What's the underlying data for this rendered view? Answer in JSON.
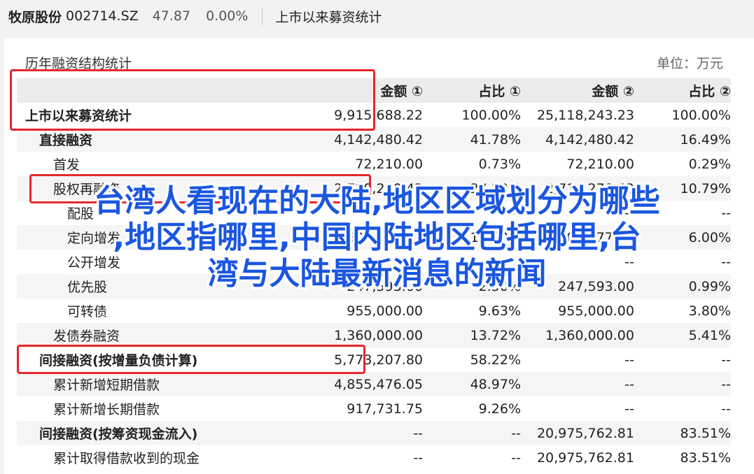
{
  "header": {
    "stock_name": "牧原股份",
    "stock_code": "002714.SZ",
    "price": "47.87",
    "change_pct": "0.00%",
    "page_title": "上市以来募资统计"
  },
  "panel": {
    "title": "历年融资结构统计",
    "unit": "单位：万元"
  },
  "table": {
    "columns": [
      "",
      "金额 ①",
      "占比 ①",
      "金额 ②",
      "占比 ②"
    ],
    "rows": [
      {
        "label": "上市以来募资统计",
        "a1": "9,915,688.22",
        "p1": "100.00%",
        "a2": "25,118,243.23",
        "p2": "100.00%"
      },
      {
        "label": "直接融资",
        "a1": "4,142,480.42",
        "p1": "41.78%",
        "a2": "4,142,480.42",
        "p2": "16.49%"
      },
      {
        "label": "首发",
        "a1": "72,210.00",
        "p1": "0.73%",
        "a2": "72,210.00",
        "p2": "0.29%"
      },
      {
        "label": "股权再融资",
        "a1": "2,710,270.42",
        "p1": "27.33%",
        "a2": "2,710,270.42",
        "p2": "10.79%"
      },
      {
        "label": "配股",
        "a1": "--",
        "p1": "--",
        "a2": "--",
        "p2": "--"
      },
      {
        "label": "定向增发",
        "a1": "1,507,677.42",
        "p1": "15.20%",
        "a2": "1,507,677.42",
        "p2": "6.00%"
      },
      {
        "label": "公开增发",
        "a1": "--",
        "p1": "--",
        "a2": "--",
        "p2": "--"
      },
      {
        "label": "优先股",
        "a1": "247,593.00",
        "p1": "2.50%",
        "a2": "247,593.00",
        "p2": "0.99%"
      },
      {
        "label": "可转债",
        "a1": "955,000.00",
        "p1": "9.63%",
        "a2": "955,000.00",
        "p2": "3.80%"
      },
      {
        "label": "发债券融资",
        "a1": "1,360,000.00",
        "p1": "13.72%",
        "a2": "1,360,000.00",
        "p2": "5.41%"
      },
      {
        "label": "间接融资(按增量负债计算)",
        "a1": "5,773,207.80",
        "p1": "58.22%",
        "a2": "--",
        "p2": "--"
      },
      {
        "label": "累计新增短期借款",
        "a1": "4,855,476.05",
        "p1": "48.97%",
        "a2": "--",
        "p2": "--"
      },
      {
        "label": "累计新增长期借款",
        "a1": "917,731.75",
        "p1": "9.26%",
        "a2": "--",
        "p2": "--"
      },
      {
        "label": "间接融资(按筹资现金流入)",
        "a1": "--",
        "p1": "--",
        "a2": "20,975,762.81",
        "p2": "83.51%"
      },
      {
        "label": "累计取得借款收到的现金",
        "a1": "--",
        "p1": "--",
        "a2": "20,975,762.81",
        "p2": "83.51%"
      }
    ]
  },
  "overlay": {
    "line1": "台湾人看现在的大陆,地区区域划分为哪些",
    "line2": ",地区指哪里,中国内陆地区包括哪里,台",
    "line3": "湾与大陆最新消息的新闻"
  }
}
